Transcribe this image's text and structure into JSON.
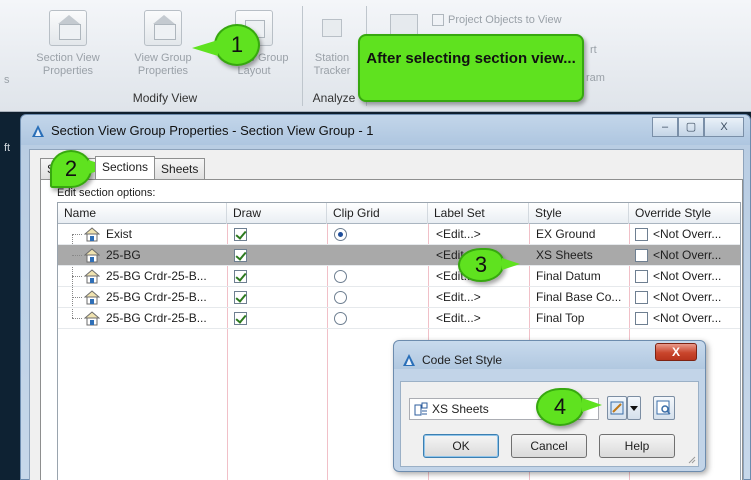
{
  "ribbon": {
    "buttons": [
      {
        "line1": "Section View",
        "line2": "Properties"
      },
      {
        "line1": "View Group",
        "line2": "Properties"
      },
      {
        "line1": "Update Group",
        "line2": "Layout"
      },
      {
        "line1": "Station",
        "line2": "Tracker"
      }
    ],
    "panels": {
      "modify_view": "Modify View",
      "analyze": "Analyze"
    },
    "project_objects": "Project Objects to View",
    "partial_1": "rt",
    "partial_2": "ram",
    "left_edge": "s"
  },
  "callouts": {
    "c1": "1",
    "c2": "2",
    "c3": "3",
    "c4": "4",
    "note": "After selecting section view..."
  },
  "dialog": {
    "title": "Section View Group Properties - Section View Group - 1",
    "min": "–",
    "max": "▢",
    "close": "X",
    "tabs": [
      "S",
      "Sections",
      "Sheets"
    ],
    "edit_label": "Edit section options:",
    "columns": [
      "Name",
      "Draw",
      "Clip Grid",
      "Label Set",
      "Style",
      "Override Style"
    ],
    "rows": [
      {
        "name": "Exist",
        "draw": true,
        "clip": true,
        "clip_visible": true,
        "label_set": "<Edit...>",
        "style": "EX Ground",
        "override": "<Not Overr..."
      },
      {
        "name": "25-BG",
        "draw": true,
        "clip": false,
        "clip_visible": false,
        "label_set": "<Edit",
        "style": "XS Sheets",
        "override": "<Not Overr...",
        "selected": true
      },
      {
        "name": "25-BG Crdr-25-B...",
        "draw": true,
        "clip": false,
        "clip_visible": true,
        "label_set": "<Edit...>",
        "style": "Final Datum",
        "override": "<Not Overr..."
      },
      {
        "name": "25-BG Crdr-25-B...",
        "draw": true,
        "clip": false,
        "clip_visible": true,
        "label_set": "<Edit...>",
        "style": "Final Base Co...",
        "override": "<Not Overr..."
      },
      {
        "name": "25-BG Crdr-25-B...",
        "draw": true,
        "clip": false,
        "clip_visible": true,
        "label_set": "<Edit...>",
        "style": "Final Top",
        "override": "<Not Overr..."
      }
    ]
  },
  "code_set": {
    "title": "Code Set Style",
    "close": "X",
    "selected": "XS Sheets",
    "ok": "OK",
    "cancel": "Cancel",
    "help": "Help"
  },
  "left_strip_text": "ft",
  "colors": {
    "callout": "#5fe21f",
    "callout_border": "#37a80f",
    "selected_row": "#a9a9a9"
  }
}
